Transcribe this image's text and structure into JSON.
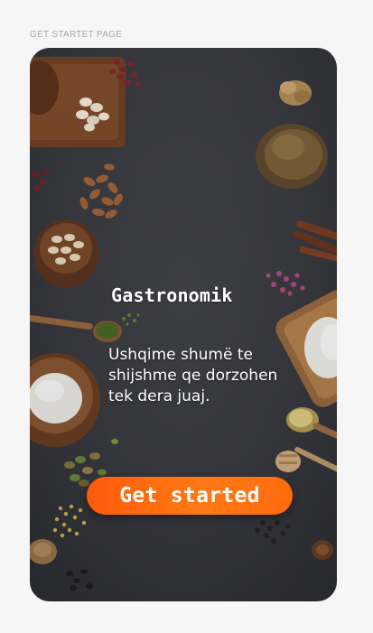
{
  "frame": {
    "label": "GET STARTET PAGE"
  },
  "onboarding": {
    "brand": "Gastronomik",
    "tagline": "Ushqime shumë te shijshme qe dorzohen tek dera juaj.",
    "cta_label": "Get started",
    "accent_color": "#ff6a10",
    "background_color": "#3a3b41"
  },
  "icons": {
    "ingredients": [
      "almonds",
      "beans",
      "pasta",
      "flour",
      "salt",
      "spices",
      "cinnamon",
      "herbs",
      "honey-dipper",
      "nuts",
      "pine-cone"
    ]
  }
}
